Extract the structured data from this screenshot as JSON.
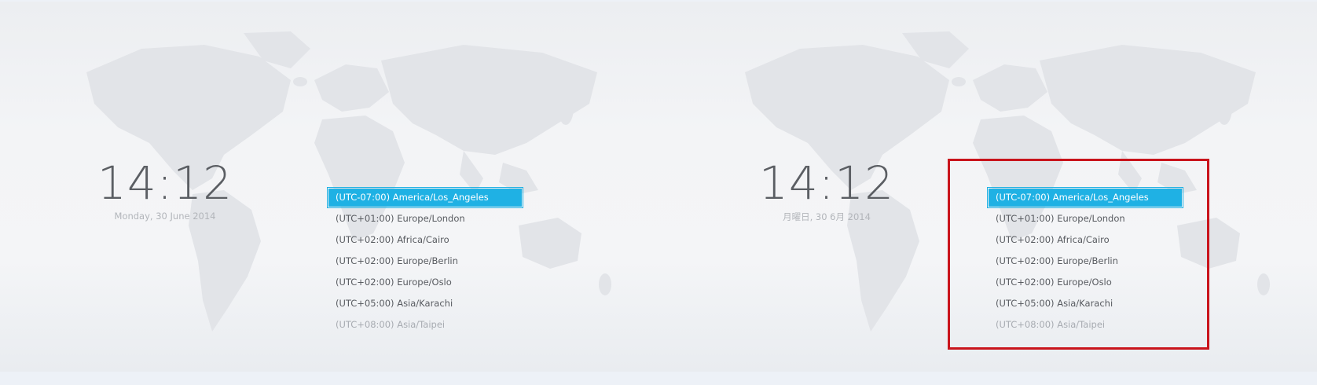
{
  "left_panel": {
    "time": "14:12",
    "date": "Monday, 30 June 2014",
    "timezones": [
      "(UTC-07:00) America/Los_Angeles",
      "(UTC+01:00) Europe/London",
      "(UTC+02:00) Africa/Cairo",
      "(UTC+02:00) Europe/Berlin",
      "(UTC+02:00) Europe/Oslo",
      "(UTC+05:00) Asia/Karachi",
      "(UTC+08:00) Asia/Taipei"
    ],
    "selected_index": 0
  },
  "right_panel": {
    "time": "14:12",
    "date": "月曜日, 30 6月 2014",
    "timezones": [
      "(UTC-07:00) America/Los_Angeles",
      "(UTC+01:00) Europe/London",
      "(UTC+02:00) Africa/Cairo",
      "(UTC+02:00) Europe/Berlin",
      "(UTC+02:00) Europe/Oslo",
      "(UTC+05:00) Asia/Karachi",
      "(UTC+08:00) Asia/Taipei"
    ],
    "selected_index": 0
  },
  "colors": {
    "selection": "#1fb1e4",
    "highlight_border": "#c9141c",
    "map": "#e2e4e8"
  },
  "icons": {
    "background": "world-map-icon"
  }
}
